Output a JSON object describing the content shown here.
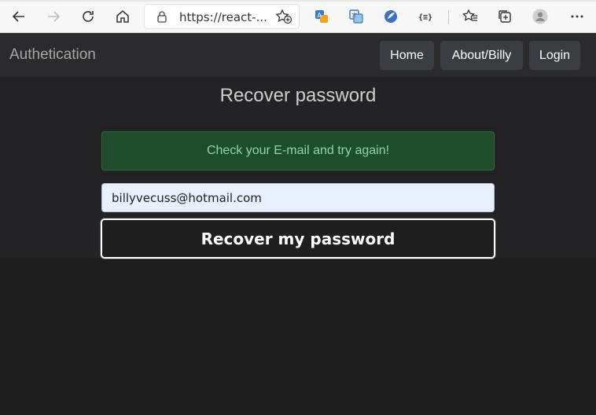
{
  "browser": {
    "url": "https://react-...",
    "icons": [
      "back-icon",
      "forward-icon",
      "refresh-icon",
      "home-icon",
      "lock-icon",
      "add-favorite-icon",
      "extension-translate-icon",
      "extension-translator-icon",
      "extension-circle-icon",
      "extension-json-icon",
      "favorites-icon",
      "collections-icon",
      "profile-avatar-icon",
      "more-icon"
    ]
  },
  "navbar": {
    "brand": "Authetication",
    "links": [
      {
        "label": "Home"
      },
      {
        "label": "About/Billy"
      },
      {
        "label": "Login"
      }
    ]
  },
  "page": {
    "title": "Recover password",
    "alert": "Check your E-mail and try again!",
    "email_value": "billyvecuss@hotmail.com",
    "submit_label": "Recover my password"
  },
  "colors": {
    "navbar_bg": "#2b2b2d",
    "page_bg": "#1e1e1e",
    "alert_bg": "#1f4d2c",
    "alert_text": "#8fd6a3",
    "input_bg": "#e8f0fe"
  }
}
